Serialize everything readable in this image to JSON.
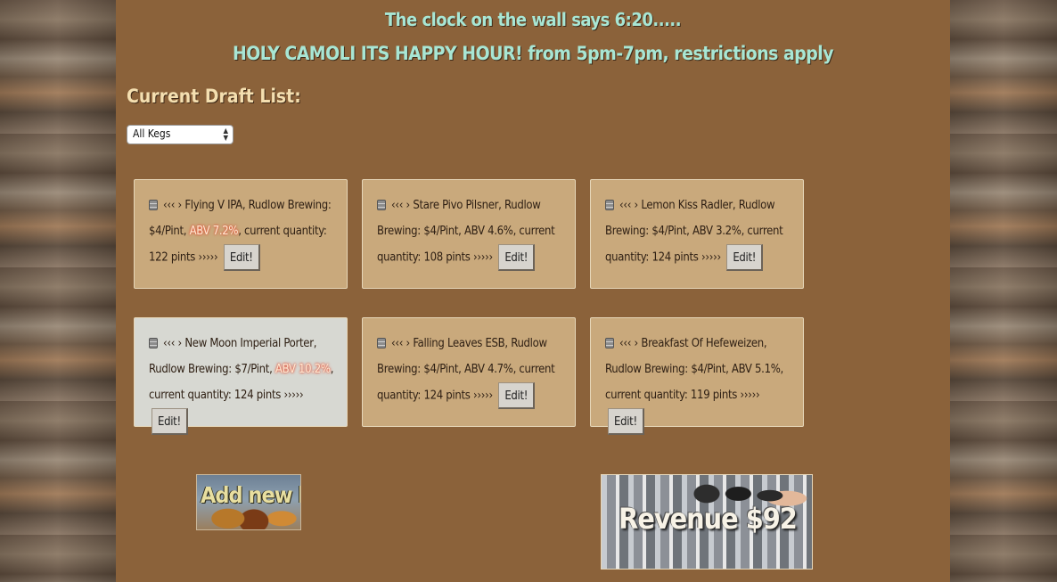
{
  "header": {
    "clock_text": "The clock on the wall says 6:20.....",
    "happy_hour_text": "HOLY CAMOLI ITS HAPPY HOUR! from 5pm-7pm, restrictions apply"
  },
  "draft_list": {
    "title": "Current Draft List:",
    "filter_selected": "All Kegs",
    "edit_label": "Edit!"
  },
  "kegs": [
    {
      "arrows": "‹‹‹ ›",
      "name": "Flying V IPA, Rudlow Brewing:",
      "price": "$4/Pint,",
      "abv": "ABV 7.2%",
      "abv_strong": true,
      "quantity": ", current quantity: 122 pints",
      "end": "›››››"
    },
    {
      "arrows": "‹‹‹ ›",
      "name": "Stare Pivo Pilsner, Rudlow Brewing:",
      "price": "$4/Pint,",
      "abv": "ABV 4.6%",
      "abv_strong": false,
      "quantity": ", current quantity: 108 pints",
      "end": "›››››"
    },
    {
      "arrows": "‹‹‹ ›",
      "name": "Lemon Kiss Radler, Rudlow Brewing:",
      "price": "$4/Pint,",
      "abv": "ABV 3.2%",
      "abv_strong": false,
      "quantity": ", current quantity: 124 pints",
      "end": "›››››"
    },
    {
      "arrows": "‹‹‹ ›",
      "name": "New Moon Imperial Porter, Rudlow Brewing:",
      "price": "$7/Pint,",
      "abv": "ABV 10.2%",
      "abv_strong": true,
      "quantity": ", current quantity: 124 pints",
      "end": "›››››"
    },
    {
      "arrows": "‹‹‹ ›",
      "name": "Falling Leaves ESB, Rudlow Brewing:",
      "price": "$4/Pint,",
      "abv": "ABV 4.7%",
      "abv_strong": false,
      "quantity": ", current quantity: 124 pints",
      "end": "›››››"
    },
    {
      "arrows": "‹‹‹ ›",
      "name": "Breakfast Of Hefeweizen, Rudlow Brewing:",
      "price": "$4/Pint,",
      "abv": "ABV 5.1%",
      "abv_strong": false,
      "quantity": ", current quantity: 119 pints",
      "end": "›››››"
    }
  ],
  "actions": {
    "add_keg_label": "Add new keg",
    "revenue_label": "Revenue $92"
  }
}
